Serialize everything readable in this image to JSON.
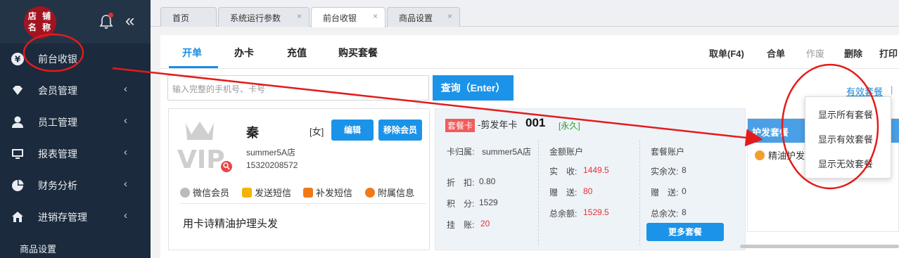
{
  "sidebar": {
    "logo_text": "店铺名称",
    "logo_line1": "店 铺",
    "logo_line2": "名 称",
    "collapse_glyph": "«",
    "items": [
      {
        "label": "前台收银",
        "icon": "yen-icon"
      },
      {
        "label": "会员管理",
        "icon": "diamond-icon"
      },
      {
        "label": "员工管理",
        "icon": "user-icon"
      },
      {
        "label": "报表管理",
        "icon": "monitor-icon"
      },
      {
        "label": "财务分析",
        "icon": "pie-chart-icon"
      },
      {
        "label": "进销存管理",
        "icon": "home-icon"
      }
    ],
    "arrow": "‹",
    "sub_item": "商品设置"
  },
  "tabs": [
    {
      "label": "首页"
    },
    {
      "label": "系统运行参数",
      "close": "×"
    },
    {
      "label": "前台收银",
      "close": "×"
    },
    {
      "label": "商品设置",
      "close": "×"
    }
  ],
  "subnav": {
    "tabs": [
      "开单",
      "办卡",
      "充值",
      "购买套餐"
    ],
    "actions": [
      "取单(F4)",
      "合单",
      "作废",
      "删除",
      "打印"
    ]
  },
  "search": {
    "placeholder": "输入完整的手机号、卡号",
    "button": "查询（Enter）"
  },
  "valid_link": "有效套餐",
  "valid_sep": "|",
  "member": {
    "name": "秦",
    "sex": "[女]",
    "edit_button": "编辑",
    "remove_button": "移除会员",
    "shop": "summer5A店",
    "phone": "15320208572",
    "links": [
      "微信会员",
      "发送短信",
      "补发短信",
      "附属信息"
    ],
    "description": "用卡诗精油护理头发"
  },
  "card": {
    "tag": "套餐卡",
    "title": "-剪发年卡",
    "number": "001",
    "validity": "[永久]",
    "col1": {
      "belong_label": "卡归属:",
      "belong_value": "summer5A店",
      "discount_label": "折　扣:",
      "discount_value": "0.80",
      "points_label": "积　分:",
      "points_value": "1529",
      "credit_label": "挂　账:",
      "credit_value": "20"
    },
    "col2": {
      "header": "金额账户",
      "received_label": "实　收:",
      "received_value": "1449.5",
      "gift_label": "赠　送:",
      "gift_value": "80",
      "total_label": "总余额:",
      "total_value": "1529.5"
    },
    "col3": {
      "header": "套餐账户",
      "remaining_label": "实余次:",
      "remaining_value": "8",
      "gift_label": "赠　送:",
      "gift_value": "0",
      "total_label": "总余次:",
      "total_value": "8"
    },
    "more_button": "更多套餐"
  },
  "right_panel": {
    "header": "护发套餐",
    "item": "精油护发"
  },
  "dropdown": [
    "显示所有套餐",
    "显示有效套餐",
    "显示无效套餐"
  ],
  "colors": {
    "sidebar": "#1b2a3c",
    "accent": "#1b93e8",
    "annotation_red": "#e41b1b"
  }
}
